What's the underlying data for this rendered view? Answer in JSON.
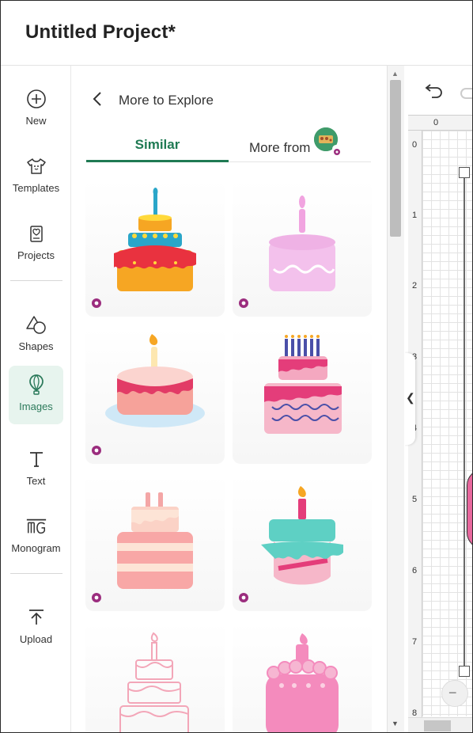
{
  "header": {
    "title": "Untitled Project*"
  },
  "nav": {
    "items": [
      {
        "label": "New",
        "icon": "plus-circle-icon"
      },
      {
        "label": "Templates",
        "icon": "tshirt-icon"
      },
      {
        "label": "Projects",
        "icon": "heart-frame-icon"
      },
      {
        "label": "Shapes",
        "icon": "shapes-icon"
      },
      {
        "label": "Images",
        "icon": "balloon-icon",
        "active": true
      },
      {
        "label": "Text",
        "icon": "text-t-icon"
      },
      {
        "label": "Monogram",
        "icon": "monogram-icon"
      },
      {
        "label": "Upload",
        "icon": "upload-icon"
      }
    ]
  },
  "panel": {
    "title": "More to Explore",
    "tabs": [
      {
        "label": "Similar",
        "active": true
      },
      {
        "label": "More from"
      }
    ]
  },
  "cards": [
    {
      "name": "three-tier-orange-cake",
      "premium": true
    },
    {
      "name": "pink-single-candle-cake",
      "premium": true
    },
    {
      "name": "plate-cake-single-candle",
      "premium": true
    },
    {
      "name": "blue-candles-layer-cake",
      "premium": false
    },
    {
      "name": "peach-drip-cake",
      "premium": true
    },
    {
      "name": "teal-drip-swirl-cake",
      "premium": true
    },
    {
      "name": "outline-pink-cake",
      "premium": false
    },
    {
      "name": "pink-bubble-cake",
      "premium": false
    }
  ],
  "canvas": {
    "ruler_top": [
      "0"
    ],
    "ruler_left": [
      "0",
      "1",
      "2",
      "3",
      "4",
      "5",
      "6",
      "7",
      "8"
    ]
  },
  "colors": {
    "accent": "#1f7a53",
    "premium": "#9b2d7e"
  }
}
